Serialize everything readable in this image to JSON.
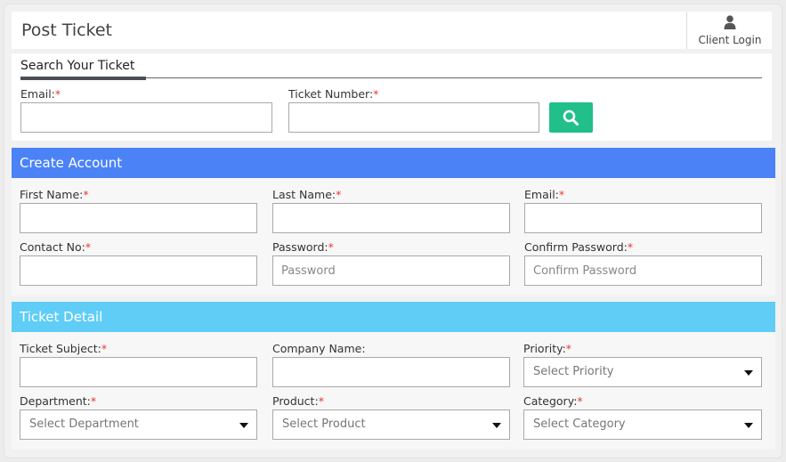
{
  "header": {
    "title": "Post Ticket",
    "client_login": "Client Login"
  },
  "search": {
    "title": "Search Your Ticket",
    "email_label": "Email:",
    "ticket_number_label": "Ticket Number:",
    "required_mark": "*"
  },
  "create_account": {
    "title": "Create Account",
    "first_name_label": "First Name:",
    "last_name_label": "Last Name:",
    "email_label": "Email:",
    "contact_label": "Contact No:",
    "password_label": "Password:",
    "password_placeholder": "Password",
    "confirm_password_label": "Confirm Password:",
    "confirm_password_placeholder": "Confirm Password"
  },
  "ticket_detail": {
    "title": "Ticket Detail",
    "subject_label": "Ticket Subject:",
    "company_label": "Company Name:",
    "priority_label": "Priority:",
    "priority_value": "Select Priority",
    "department_label": "Department:",
    "department_value": "Select Department",
    "product_label": "Product:",
    "product_value": "Select Product",
    "category_label": "Category:",
    "category_value": "Select Category"
  },
  "colors": {
    "create_account_header": "#4b82f6",
    "ticket_detail_header": "#5fcdf6",
    "search_button": "#21bf8a",
    "required": "#e53935"
  },
  "icons": {
    "client_login": "user-icon",
    "search_button": "search-icon",
    "select_caret": "caret-down-icon"
  }
}
